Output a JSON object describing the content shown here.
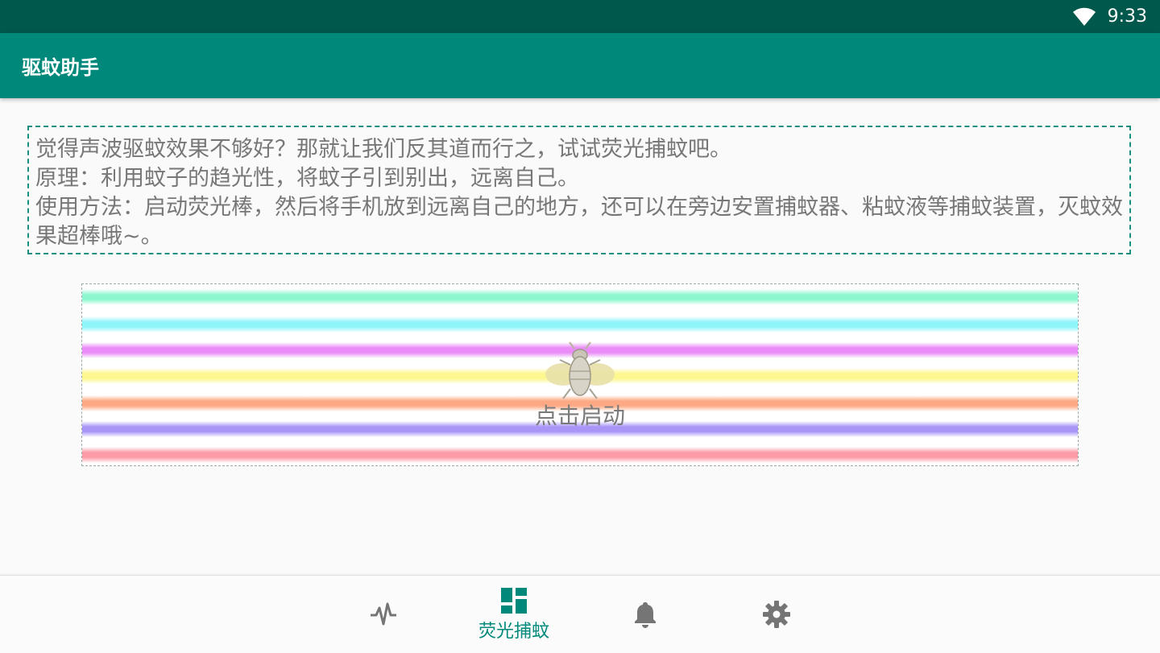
{
  "status_bar": {
    "time": "9:33",
    "icons": [
      "wifi-icon"
    ]
  },
  "app_bar": {
    "title": "驱蚊助手"
  },
  "description": {
    "lines": [
      "觉得声波驱蚊效果不够好？那就让我们反其道而行之，试试荧光捕蚊吧。",
      "原理：利用蚊子的趋光性，将蚊子引到别出，远离自己。",
      "使用方法：启动荧光棒，然后将手机放到远离自己的地方，还可以在旁边安置捕蚊器、粘蚊液等捕蚊装置，灭蚊效果超棒哦~。"
    ]
  },
  "fluorescent": {
    "stripe_colors": [
      "#8ef7cf",
      "#8ef5fb",
      "#e98cf7",
      "#fdf78d",
      "#fea983",
      "#a895f7",
      "#fc9ba6"
    ],
    "icon": "mosquito-icon",
    "start_label": "点击启动"
  },
  "bottom_nav": {
    "active_color": "#00897b",
    "inactive_color": "#757575",
    "items": [
      {
        "icon": "pulse-icon",
        "label": ""
      },
      {
        "icon": "dashboard-icon",
        "label": "荧光捕蚊"
      },
      {
        "icon": "bell-icon",
        "label": ""
      },
      {
        "icon": "gear-icon",
        "label": ""
      }
    ]
  }
}
